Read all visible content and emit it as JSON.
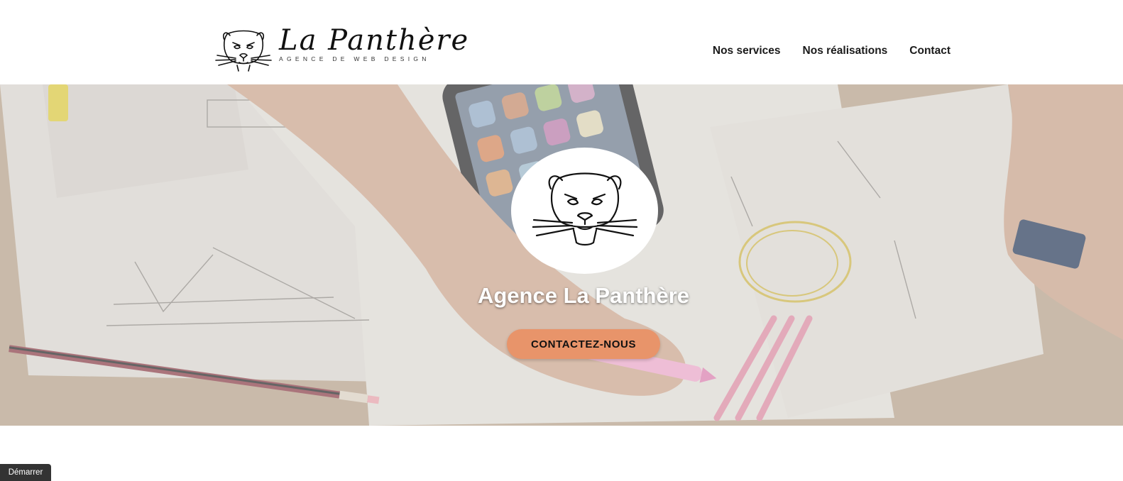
{
  "header": {
    "brand": {
      "name": "La Panthère",
      "tagline": "AGENCE DE WEB DESIGN",
      "logo_icon": "panther-head-icon"
    },
    "nav": [
      {
        "label": "Nos services"
      },
      {
        "label": "Nos réalisations"
      },
      {
        "label": "Contact"
      }
    ]
  },
  "hero": {
    "background": "workspace-sketches-photo",
    "logo_icon": "panther-head-icon",
    "title": "Agence La Panthère",
    "cta_label": "CONTACTEZ-NOUS"
  },
  "footer": {
    "start_label": "Démarrer"
  },
  "colors": {
    "accent_button": "#e8946a",
    "nav_text": "#1a1a1a",
    "hero_overlay": "#b8aa98",
    "start_tab": "#333333"
  }
}
